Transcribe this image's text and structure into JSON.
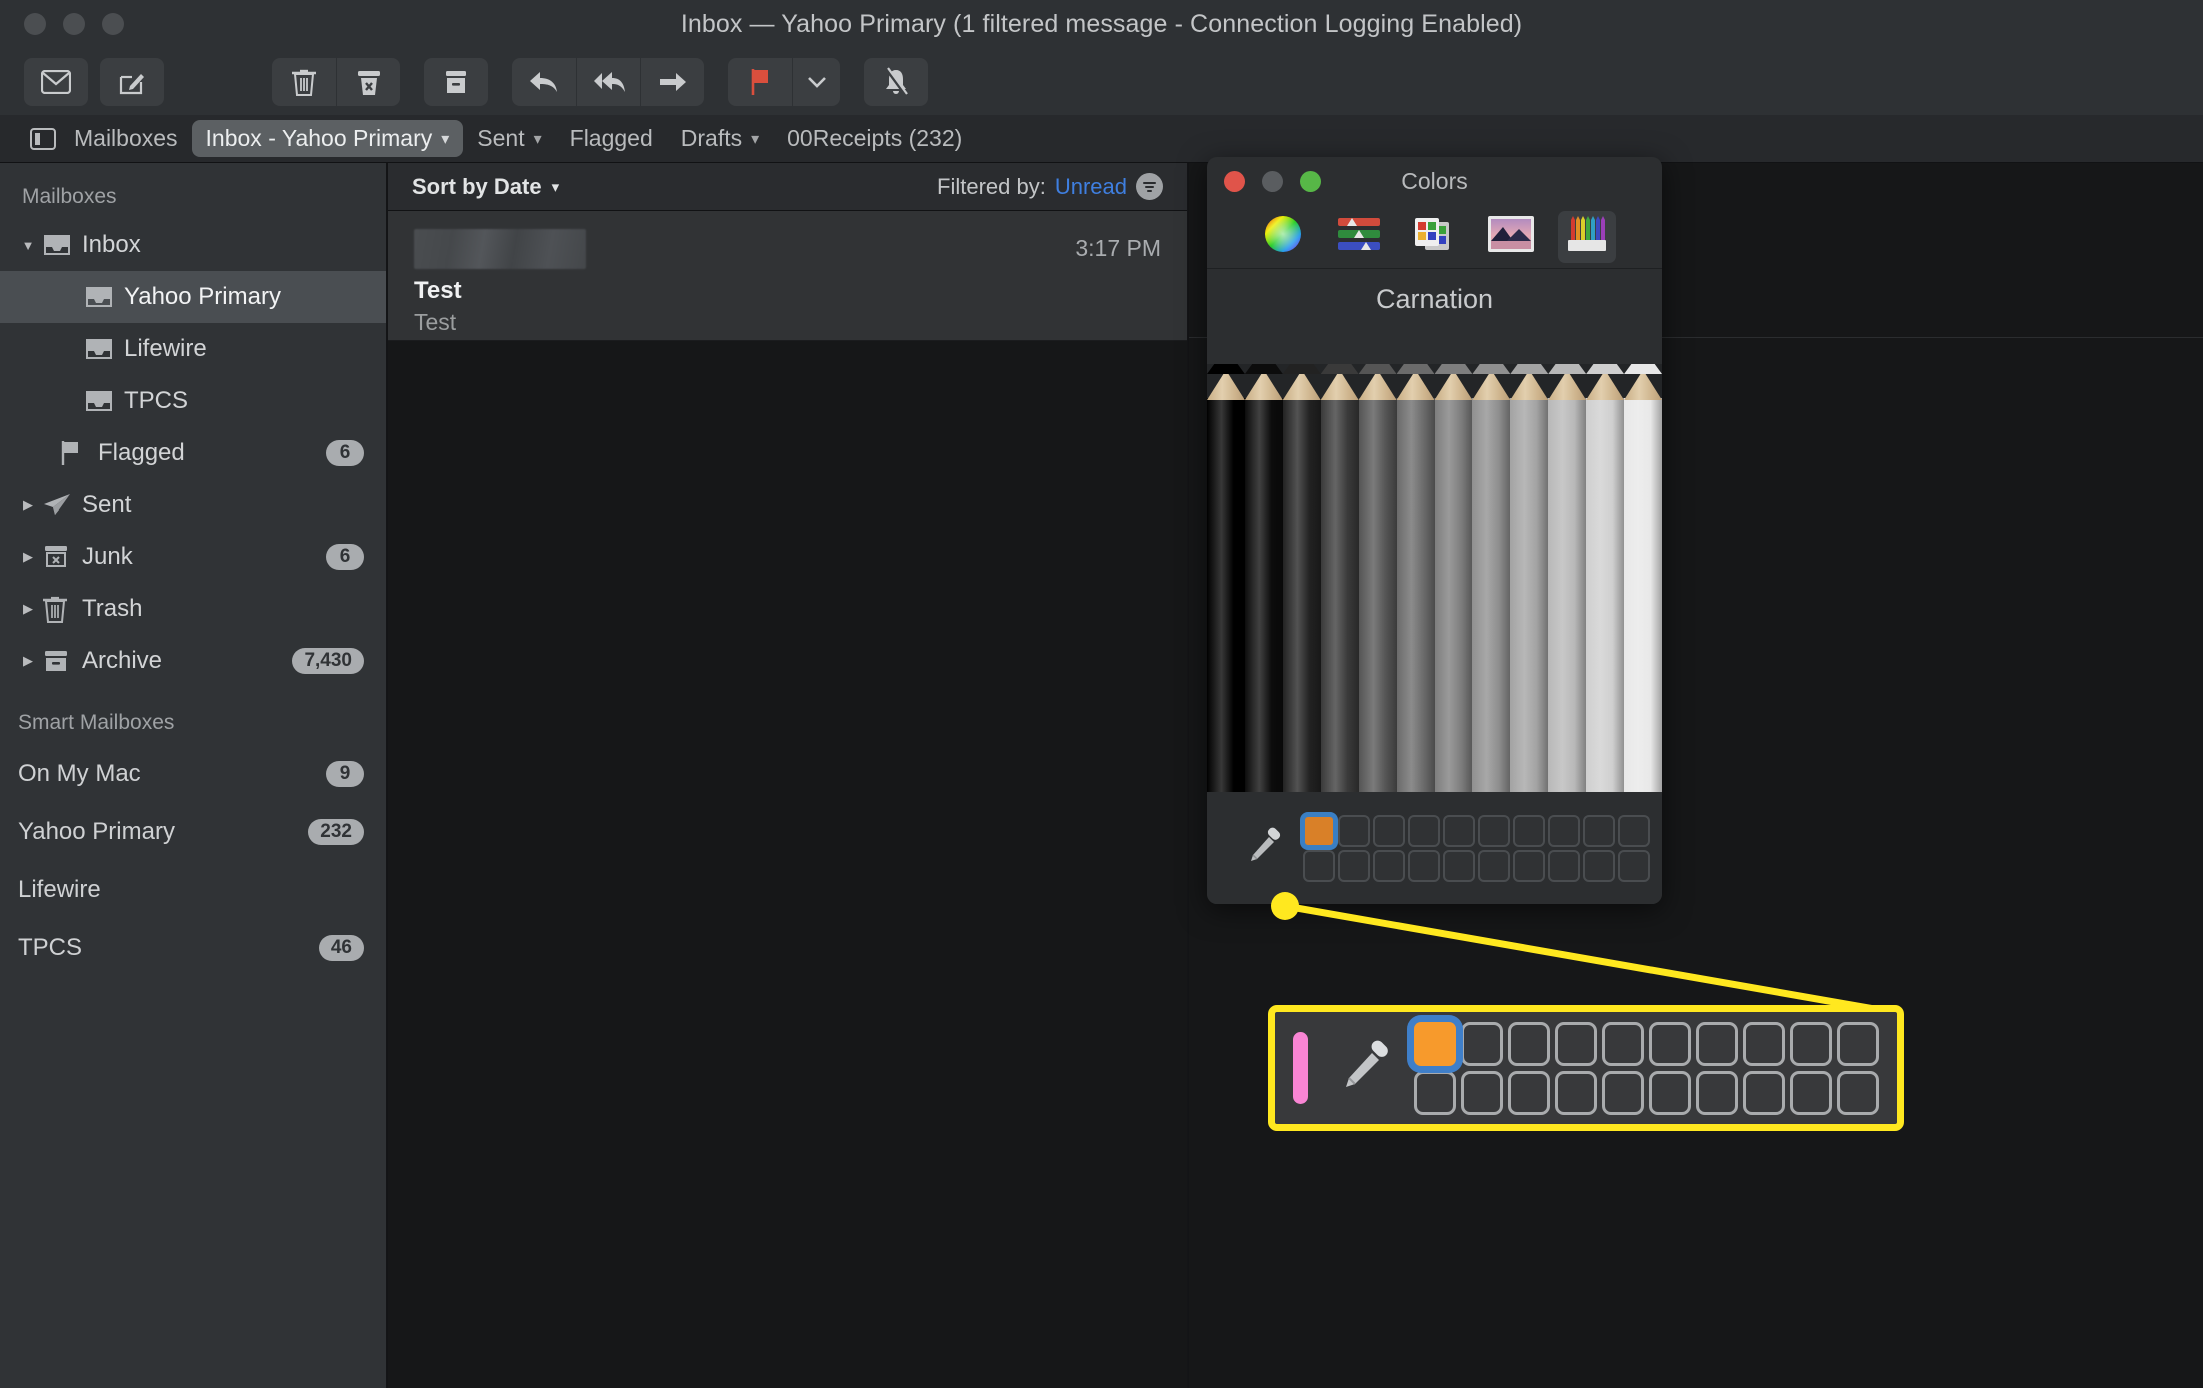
{
  "window": {
    "title": "Inbox — Yahoo Primary (1 filtered message - Connection Logging Enabled)"
  },
  "toolbar": {
    "buttons": [
      {
        "name": "get-mail-button",
        "icon": "envelope-icon",
        "label": "Get Mail"
      },
      {
        "name": "compose-button",
        "icon": "compose-icon",
        "label": "New Message"
      },
      {
        "name": "delete-button",
        "icon": "trash-icon",
        "label": "Delete"
      },
      {
        "name": "junk-button",
        "icon": "junk-icon",
        "label": "Mark as Junk"
      },
      {
        "name": "archive-button",
        "icon": "archive-icon",
        "label": "Archive"
      },
      {
        "name": "reply-button",
        "icon": "reply-icon",
        "label": "Reply"
      },
      {
        "name": "reply-all-button",
        "icon": "reply-all-icon",
        "label": "Reply All"
      },
      {
        "name": "forward-button",
        "icon": "forward-icon",
        "label": "Forward"
      },
      {
        "name": "flag-button",
        "icon": "flag-icon",
        "label": "Flag"
      },
      {
        "name": "flag-menu-button",
        "icon": "chevron-down-icon",
        "label": "Flag Options"
      },
      {
        "name": "mute-button",
        "icon": "bell-slash-icon",
        "label": "Mute"
      }
    ]
  },
  "tabbar": {
    "sidebar_toggle_label": "Mailboxes",
    "tabs": [
      {
        "label": "Inbox - Yahoo Primary",
        "has_chevron": true,
        "active": true
      },
      {
        "label": "Sent",
        "has_chevron": true,
        "active": false
      },
      {
        "label": "Flagged",
        "has_chevron": false,
        "active": false
      },
      {
        "label": "Drafts",
        "has_chevron": true,
        "active": false
      },
      {
        "label": "00Receipts (232)",
        "has_chevron": false,
        "active": false
      }
    ]
  },
  "sidebar": {
    "header": "Mailboxes",
    "items": [
      {
        "label": "Inbox",
        "icon": "inbox-icon",
        "disclosure": "open",
        "indent": 1,
        "count": ""
      },
      {
        "label": "Yahoo Primary",
        "icon": "inbox-icon",
        "disclosure": "none",
        "indent": 2,
        "count": "",
        "selected": true
      },
      {
        "label": "Lifewire",
        "icon": "inbox-icon",
        "disclosure": "none",
        "indent": 2,
        "count": ""
      },
      {
        "label": "TPCS",
        "icon": "inbox-icon",
        "disclosure": "none",
        "indent": 2,
        "count": ""
      },
      {
        "label": "Flagged",
        "icon": "flag-icon",
        "disclosure": "none",
        "indent": 3,
        "count": "6"
      },
      {
        "label": "Sent",
        "icon": "sent-icon",
        "disclosure": "closed",
        "indent": 1,
        "count": ""
      },
      {
        "label": "Junk",
        "icon": "junk-icon",
        "disclosure": "closed",
        "indent": 1,
        "count": "6"
      },
      {
        "label": "Trash",
        "icon": "trash-icon",
        "disclosure": "closed",
        "indent": 1,
        "count": ""
      },
      {
        "label": "Archive",
        "icon": "archive-icon",
        "disclosure": "closed",
        "indent": 1,
        "count": "7,430"
      }
    ],
    "smart_header": "Smart Mailboxes",
    "smart_items": [
      {
        "label": "On My Mac",
        "count": "9"
      },
      {
        "label": "Yahoo Primary",
        "count": "232"
      },
      {
        "label": "Lifewire",
        "count": ""
      },
      {
        "label": "TPCS",
        "count": "46"
      }
    ]
  },
  "message_list": {
    "sort_label": "Sort by Date",
    "filter_prefix": "Filtered by:",
    "filter_value": "Unread",
    "messages": [
      {
        "sender": "",
        "sender_redacted": true,
        "subject": "Test",
        "preview": "Test",
        "time": "3:17 PM"
      }
    ]
  },
  "colors_panel": {
    "title": "Colors",
    "modes": [
      {
        "name": "color-wheel-mode",
        "icon": "color-wheel-icon",
        "selected": false
      },
      {
        "name": "color-sliders-mode",
        "icon": "sliders-icon",
        "selected": false
      },
      {
        "name": "color-palettes-mode",
        "icon": "palette-icon",
        "selected": false
      },
      {
        "name": "image-palettes-mode",
        "icon": "image-icon",
        "selected": false
      },
      {
        "name": "pencils-mode",
        "icon": "pencils-icon",
        "selected": true
      }
    ],
    "selected_swatch_name": "Carnation",
    "current_color": "#c57cba",
    "dropper_label": "Eyedropper",
    "swatch_rows": 2,
    "swatch_cols": 10,
    "saved_swatches": [
      {
        "index": 0,
        "color": "#d98028",
        "selected": true
      }
    ]
  },
  "callout": {
    "border_color": "#ffe81f",
    "current_color": "#f985d4",
    "dropper_label": "Eyedropper",
    "swatch_rows": 2,
    "swatch_cols": 10,
    "saved_swatches": [
      {
        "index": 0,
        "color": "#f79a2c",
        "selected": true
      }
    ],
    "highlight_color": "#3f7fc9"
  },
  "pencil_grid": {
    "columns": 12,
    "rows": 11,
    "colors": [
      [
        "#000000",
        "#0c0c0c",
        "#222222",
        "#3a3a3a",
        "#555555",
        "#6b6b6b",
        "#7e7e7e",
        "#8f8f8f",
        "#a3a3a3",
        "#b8b8b8",
        "#cfcfcf",
        "#e8e8e8"
      ],
      [
        "#7d0f14",
        "#7a4a0b",
        "#6e6e12",
        "#3f6612",
        "#16631f",
        "#0c5e3c",
        "#0e5a63",
        "#0d3f79",
        "#10128c",
        "#3b0e80",
        "#6e0f6b",
        "#78103a"
      ],
      [
        "#8e1218",
        "#8c5a0d",
        "#828216",
        "#4d7a16",
        "#1b7626",
        "#0f6f47",
        "#116b75",
        "#104a8e",
        "#1316a3",
        "#460f96",
        "#821280",
        "#8d1344"
      ],
      [
        "#b0161d",
        "#ad700f",
        "#a3a31c",
        "#60991b",
        "#22932f",
        "#128a59",
        "#158592",
        "#135cb0",
        "#181ac9",
        "#5612bb",
        "#a2169f",
        "#b01755"
      ],
      [
        "#d22229",
        "#d08d18",
        "#c6c422",
        "#76b820",
        "#2cb03a",
        "#17a76c",
        "#1aa2b0",
        "#1770d3",
        "#1e20ee",
        "#6a17e0",
        "#c51bc0",
        "#d21e66"
      ],
      [
        "#e2453f",
        "#e0a53a",
        "#dcd744",
        "#93c83c",
        "#49c159",
        "#3bbb85",
        "#46bcc6",
        "#3c8bdd",
        "#2d36f0",
        "#8136e8",
        "#d83cd0",
        "#e0447e"
      ],
      [
        "#e66a5e",
        "#e5b85e",
        "#e3df68",
        "#a8d25f",
        "#69cb75",
        "#5fc79a",
        "#68c9d2",
        "#60a0e2",
        "#5160f2",
        "#9659ec",
        "#de61d8",
        "#e56894"
      ],
      [
        "#ea8d7e",
        "#eac882",
        "#e9e68a",
        "#bcda83",
        "#8ad693",
        "#85d4b0",
        "#8ad7de",
        "#84b6e8",
        "#7d8bf5",
        "#ab7cf0",
        "#e584df",
        "#e98aa9"
      ],
      [
        "#efaf9f",
        "#f0d9a7",
        "#f0edad",
        "#d1e3a8",
        "#abe0b2",
        "#aae1c7",
        "#aee5e9",
        "#a9cbee",
        "#a4b2f8",
        "#c4a1f4",
        "#eba7e6",
        "#eeadc0"
      ],
      [
        "#c0676c",
        "#c19a6f",
        "#bcbf72",
        "#96b56c",
        "#6fb47a",
        "#62b19a",
        "#69b2b6",
        "#6a95c3",
        "#5e61c3",
        "#8a63c4",
        "#b06ac2",
        "#c06f9a"
      ],
      [
        "#b5595f",
        "#b68b62",
        "#b1b266",
        "#88a85f",
        "#61a76d",
        "#53a38d",
        "#5aa5aa",
        "#5b88b7",
        "#4f54b7",
        "#7d56b8",
        "#a45cb6",
        "#b4618d"
      ]
    ]
  }
}
